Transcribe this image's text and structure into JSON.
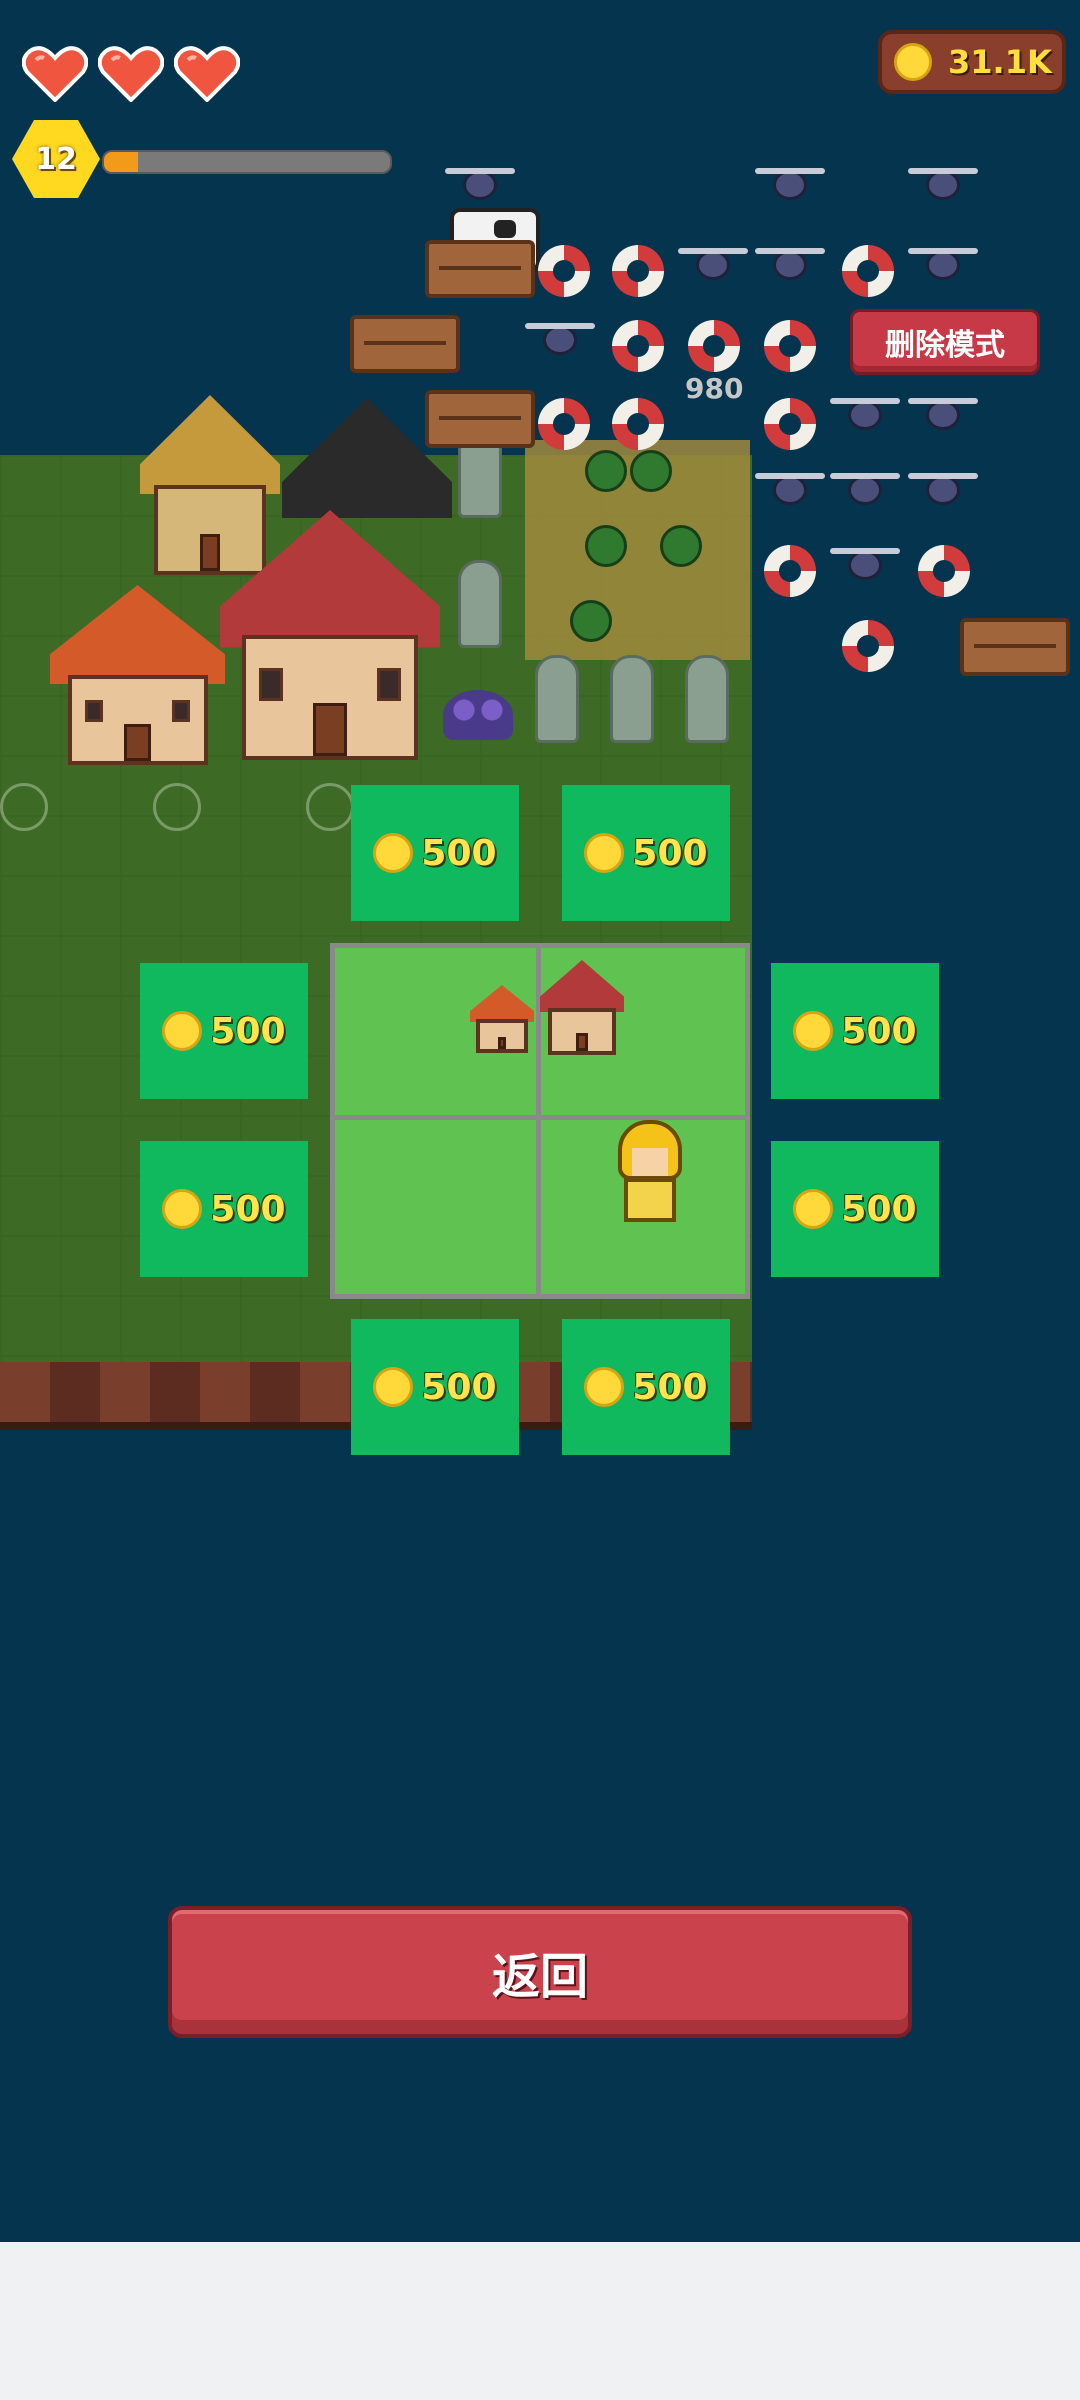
{
  "hud": {
    "hearts": [
      {
        "icon": "heart-icon",
        "full": true
      },
      {
        "icon": "heart-icon",
        "full": true
      },
      {
        "icon": "heart-icon",
        "full": true
      }
    ],
    "level": "12",
    "xp_progress": 0.12,
    "coins": "31.1K"
  },
  "buttons": {
    "delete_mode": "删除模式",
    "back": "返回"
  },
  "world": {
    "counter_label": "980"
  },
  "expansion_tiles": [
    {
      "id": "top-left",
      "price": "500"
    },
    {
      "id": "top-right",
      "price": "500"
    },
    {
      "id": "left-upper",
      "price": "500"
    },
    {
      "id": "right-upper",
      "price": "500"
    },
    {
      "id": "left-lower",
      "price": "500"
    },
    {
      "id": "right-lower",
      "price": "500"
    },
    {
      "id": "bottom-left",
      "price": "500"
    },
    {
      "id": "bottom-right",
      "price": "500"
    }
  ],
  "colors": {
    "water": "#05344e",
    "grass": "#3d6b26",
    "plot": "#5fc251",
    "tile": "#10b95e",
    "price_text": "#ffe44d",
    "heart": "#f0553f",
    "level_badge": "#ffd81f",
    "xp_fill": "#f29a1a",
    "delete_button": "#c73946",
    "back_button": "#c9424c"
  }
}
